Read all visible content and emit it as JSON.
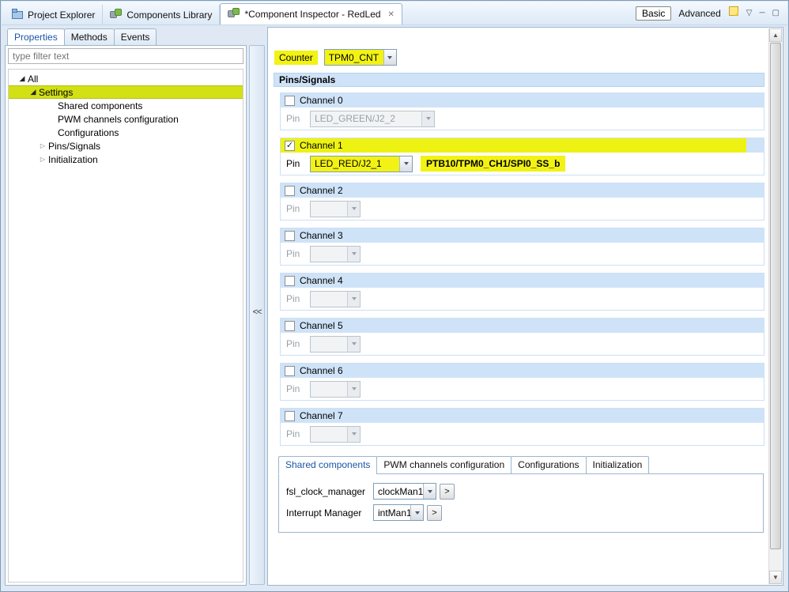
{
  "icons": {
    "checkmark": "✓",
    "collapsed_arrow": "▷",
    "expanded_arrow": "◢",
    "close": "✕",
    "scroll_up": "▲",
    "scroll_down": "▼",
    "menu_chevron": "▽",
    "minimize": "─",
    "maximize": "▢"
  },
  "window": {
    "tabs": [
      {
        "label": "Project Explorer"
      },
      {
        "label": "Components Library"
      },
      {
        "label": "*Component Inspector - RedLed",
        "active": true
      }
    ],
    "toolbar": {
      "basic": "Basic",
      "advanced": "Advanced"
    }
  },
  "left_panel": {
    "tabs": [
      {
        "label": "Properties",
        "active": true
      },
      {
        "label": "Methods"
      },
      {
        "label": "Events"
      }
    ],
    "filter_placeholder": "type filter text",
    "tree": [
      {
        "label": "All",
        "state": "expanded"
      },
      {
        "label": "Settings",
        "state": "expanded",
        "selected": true
      },
      {
        "label": "Shared components",
        "state": "leaf"
      },
      {
        "label": "PWM channels configuration",
        "state": "leaf"
      },
      {
        "label": "Configurations",
        "state": "leaf"
      },
      {
        "label": "Pins/Signals",
        "state": "collapsed"
      },
      {
        "label": "Initialization",
        "state": "collapsed"
      }
    ]
  },
  "collapse_button": "<<",
  "right_panel": {
    "counter_label": "Counter",
    "counter_value": "TPM0_CNT",
    "pins_signals_header": "Pins/Signals",
    "pin_label": "Pin",
    "channels": [
      {
        "label": "Channel 0",
        "checked": false,
        "pin_value": "LED_GREEN/J2_2",
        "pin_detail": ""
      },
      {
        "label": "Channel 1",
        "checked": true,
        "pin_value": "LED_RED/J2_1",
        "pin_detail": "PTB10/TPM0_CH1/SPI0_SS_b"
      },
      {
        "label": "Channel 2",
        "checked": false,
        "pin_value": "",
        "pin_detail": ""
      },
      {
        "label": "Channel 3",
        "checked": false,
        "pin_value": "",
        "pin_detail": ""
      },
      {
        "label": "Channel 4",
        "checked": false,
        "pin_value": "",
        "pin_detail": ""
      },
      {
        "label": "Channel 5",
        "checked": false,
        "pin_value": "",
        "pin_detail": ""
      },
      {
        "label": "Channel 6",
        "checked": false,
        "pin_value": "",
        "pin_detail": ""
      },
      {
        "label": "Channel 7",
        "checked": false,
        "pin_value": "",
        "pin_detail": ""
      }
    ],
    "bottom_tabs": [
      {
        "label": "Shared components",
        "active": true
      },
      {
        "label": "PWM channels configuration"
      },
      {
        "label": "Configurations"
      },
      {
        "label": "Initialization"
      }
    ],
    "shared_rows": [
      {
        "label": "fsl_clock_manager",
        "value": "clockMan1",
        "goto": ">"
      },
      {
        "label": "Interrupt Manager",
        "value": "intMan1",
        "goto": ">"
      }
    ]
  }
}
